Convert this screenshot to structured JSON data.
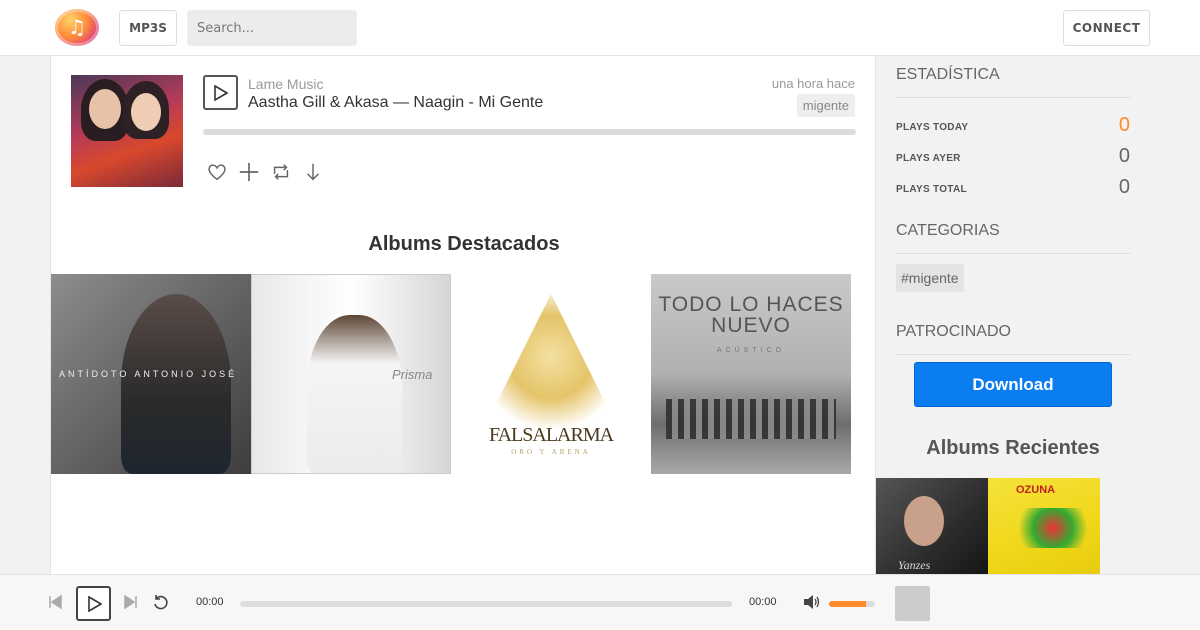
{
  "header": {
    "logo_icon": "music-note-icon",
    "mp3s_label": "MP3S",
    "search_placeholder": "Search...",
    "connect_label": "CONNECT"
  },
  "track": {
    "artist": "Lame Music",
    "title": "Aastha Gill & Akasa — Naagin - Mi Gente",
    "time_ago": "una hora hace",
    "tag": "migente",
    "actions": [
      "heart-icon",
      "plus-icon",
      "repost-icon",
      "download-icon"
    ]
  },
  "featured": {
    "heading": "Albums Destacados",
    "albums": [
      {
        "cover_text": "ANTÍDOTO ANTONIO JOSÉ"
      },
      {
        "cover_text": "Prisma"
      },
      {
        "cover_text": "FALSALARMA",
        "cover_subtext": "ORO Y ARENA"
      },
      {
        "cover_text": "TODO LO HACES NUEVO",
        "cover_subtext": "ACÚSTICO"
      }
    ]
  },
  "sidebar": {
    "stats_title": "ESTADÍSTICA",
    "stats": [
      {
        "label": "PLAYS TODAY",
        "value": "0"
      },
      {
        "label": "PLAYS AYER",
        "value": "0"
      },
      {
        "label": "PLAYS TOTAL",
        "value": "0"
      }
    ],
    "categories_title": "CATEGORIAS",
    "category_tag": "#migente",
    "sponsored_title": "PATROCINADO",
    "download_label": "Download",
    "recent_heading": "Albums Recientes",
    "recent_albums": [
      {
        "cover_text": "Yanzes"
      },
      {
        "cover_text": "OZUNA"
      }
    ]
  },
  "player": {
    "current_time": "00:00",
    "duration": "00:00",
    "progress": 0,
    "volume": 0.8
  },
  "colors": {
    "accent": "#ff8a2a",
    "download": "#0a7df0"
  }
}
